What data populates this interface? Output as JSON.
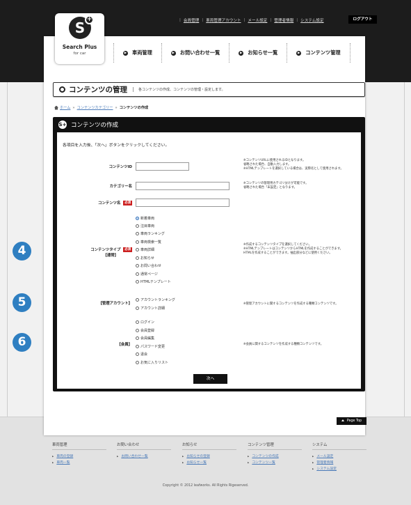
{
  "brand": {
    "name": "Search Plus",
    "sub": "for car",
    "mark": "S"
  },
  "top_links": [
    "会員管理",
    "車両管理アカウント",
    "メール設定",
    "管理者情報",
    "システム設定"
  ],
  "logout": "ログアウト",
  "nav": [
    "車両管理",
    "お問い合わせ一覧",
    "お知らせ一覧",
    "コンテンツ管理"
  ],
  "page": {
    "title": "コンテンツの管理",
    "description": "各コンテンツの作成、コンテンツの管理・設定します。"
  },
  "breadcrumb": {
    "items": [
      "ホーム",
      "コンテンツカテゴリー"
    ],
    "current": "コンテンツの作成"
  },
  "panel": {
    "title": "コンテンツの作成",
    "intro": "各項目を入力後、「次へ」ボタンをクリックしてください。"
  },
  "form": {
    "content_id": {
      "label": "コンテンツID",
      "value": "",
      "notes": [
        "※コンテンツURLに使用されるIDとなります。",
        "省略された場合、自動入力します。",
        "※HTMLテンプレートを選択している場合は、実際名として使用されます。"
      ]
    },
    "category_name": {
      "label": "カテゴリー名",
      "value": "",
      "notes": [
        "※コンテンツの管理用カテゴリ分けが可能です。",
        "省略された場合「未設定」となります。"
      ]
    },
    "content_name": {
      "label": "コンテンツ名",
      "required": "必須",
      "value": ""
    },
    "type": {
      "label": "コンテンツタイプ",
      "sub": "【通常】",
      "required": "必須",
      "options": [
        "新着車両",
        "注目車両",
        "車両ランキング",
        "車両検索一覧",
        "車両詳細",
        "お知らせ",
        "お問い合わせ",
        "通常ページ",
        "HTMLテンプレート"
      ],
      "notes": [
        "※作成するコンテンツタイプを選択してください。",
        "※HTMLテンプレートはコンテンツからHTMLを作成することができます。",
        "HTMLを作成することができます。抽出部分などに使用ください。"
      ]
    },
    "admin": {
      "label": "【管理アカウント】",
      "options": [
        "アカウントランキング",
        "アカウント詳細"
      ],
      "note": "※管理アカウントに関するコンテンツを作成する種類コンテンツです。"
    },
    "member": {
      "label": "【会員】",
      "options": [
        "ログイン",
        "会員登録",
        "会員編集",
        "パスワード変更",
        "退会",
        "お気に入りリスト"
      ],
      "note": "※会員に関するコンテンツを作成する種類コンテンツです。"
    }
  },
  "next_button": "次へ",
  "badges": [
    "4",
    "5",
    "6"
  ],
  "page_top": "Page Top",
  "footer": {
    "columns": [
      {
        "title": "車両管理",
        "links": [
          "車両の登録",
          "車両一覧"
        ]
      },
      {
        "title": "お問い合わせ",
        "links": [
          "お問い合わせ一覧"
        ]
      },
      {
        "title": "お知らせ",
        "links": [
          "お知らせの登録",
          "お知らせ一覧"
        ]
      },
      {
        "title": "コンテンツ管理",
        "links": [
          "コンテンツの作成",
          "コンテンツ一覧"
        ]
      },
      {
        "title": "システム",
        "links": [
          "メール設定",
          "管理者情報",
          "システム設定"
        ]
      }
    ],
    "copyright": "Copyright © 2012 leafworks. All Rights Rigeserved."
  },
  "colors": {
    "accent_badge": "#2f7fc1",
    "required": "#cc1f1f",
    "link": "#4a7ab8",
    "header": "#1c1c1c"
  }
}
